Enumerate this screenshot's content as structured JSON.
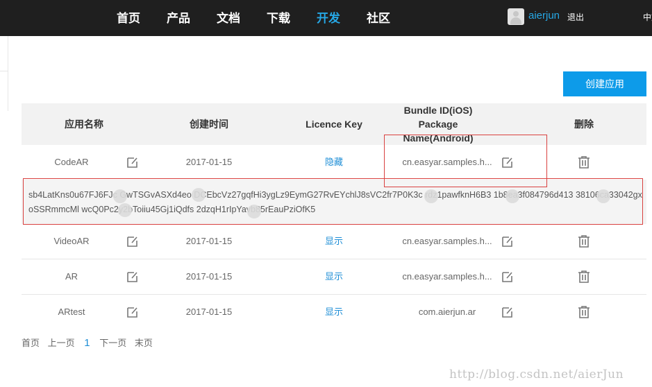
{
  "nav": {
    "items": [
      "首页",
      "产品",
      "文档",
      "下载",
      "开发",
      "社区"
    ],
    "active": "开发",
    "username": "aierjun",
    "logout": "退出",
    "lang": "中文"
  },
  "actions": {
    "create_app": "创建应用"
  },
  "table": {
    "headers": {
      "app_name": "应用名称",
      "created": "创建时间",
      "licence_key": "Licence Key",
      "bundle_line1": "Bundle ID(iOS)",
      "bundle_line2": "Package",
      "bundle_line3": "Name(Android)",
      "delete": "删除"
    },
    "rows": [
      {
        "name": "CodeAR",
        "date": "2017-01-15",
        "key_action": "隐藏",
        "bundle": "cn.easyar.samples.h..."
      },
      {
        "name": "VideoAR",
        "date": "2017-01-15",
        "key_action": "显示",
        "bundle": "cn.easyar.samples.h..."
      },
      {
        "name": "AR",
        "date": "2017-01-15",
        "key_action": "显示",
        "bundle": "cn.easyar.samples.h..."
      },
      {
        "name": "ARtest",
        "date": "2017-01-15",
        "key_action": "显示",
        "bundle": "com.aierjun.ar"
      }
    ],
    "licence_key_text": "sb4LatKns0u67FJ6FJc GwTSGvASXd4eo DCEbcVz27gqfHi3ygLz9EymG27RvEYchlJ8sVC2fr7P0K3c rdz1pawfknH6B3 1b8ea3f084796d413 38106ca33042gxoSSRmmcMl wcQ0Pc2y2bToiiu45Gj1iQdfs 2dzqH1rIpYavb85rEauPziOfK5"
  },
  "pager": {
    "first": "首页",
    "prev": "上一页",
    "current": "1",
    "next": "下一页",
    "last": "末页"
  },
  "watermark": "http://blog.csdn.net/aierJun",
  "colors": {
    "accent": "#26a8e6",
    "button": "#0d9be9",
    "highlight_border": "#d9403f"
  }
}
